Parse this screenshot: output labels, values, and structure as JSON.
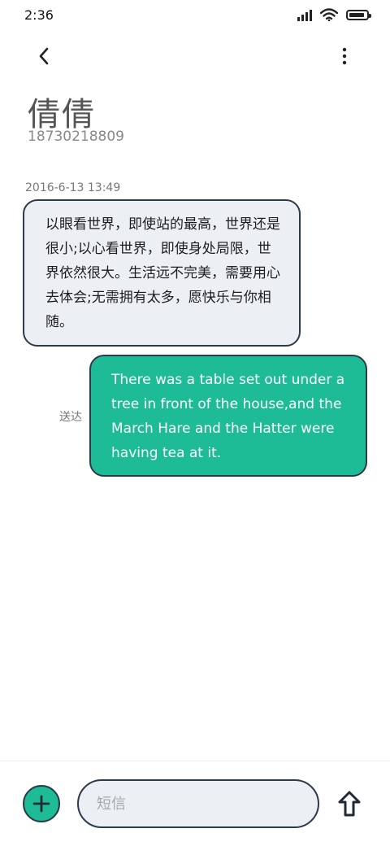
{
  "status_bar": {
    "time": "2:36",
    "icons": [
      "signal-icon",
      "wifi-icon",
      "battery-icon"
    ],
    "battery_level": 0.9
  },
  "header": {
    "back_icon": "back-arrow-icon",
    "more_icon": "more-vertical-icon",
    "contact_name": "倩倩",
    "contact_number": "18730218809"
  },
  "conversation": {
    "timestamp": "2016-6-13 13:49",
    "messages": [
      {
        "direction": "incoming",
        "text": "以眼看世界，即使站的最高，世界还是很小;以心看世界，即使身处局限，世界依然很大。生活远不完美，需要用心去体会;无需拥有太多，愿快乐与你相随。"
      },
      {
        "direction": "outgoing",
        "text": "There was a table set out under a tree in front of the house,and the March Hare and the Hatter were having tea at it.",
        "status": "送达"
      }
    ]
  },
  "composer": {
    "add_icon": "plus-icon",
    "placeholder": "短信",
    "value": "",
    "send_icon": "send-arrow-icon"
  },
  "colors": {
    "accent": "#1dbb96",
    "bubble_incoming": "#eceff4",
    "outline": "#2d3a4a"
  }
}
